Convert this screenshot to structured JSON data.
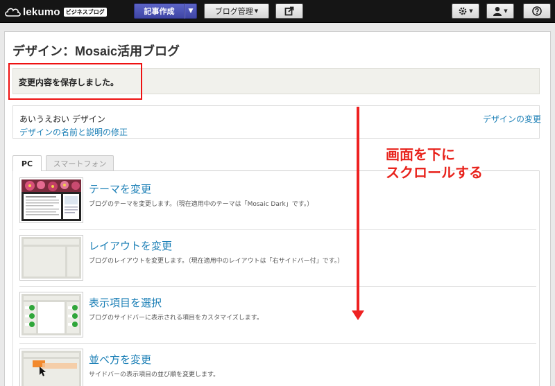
{
  "topbar": {
    "logo_text": "lekumo",
    "logo_badge": "ビジネスブログ",
    "new_post_label": "記事作成",
    "blog_mgmt_label": "ブログ管理",
    "icons": [
      "cloud-logo-icon",
      "external-link-icon",
      "gear-icon",
      "user-icon",
      "help-icon"
    ]
  },
  "page": {
    "title": "デザイン：Mosaic活用ブログ",
    "saved_message": "変更内容を保存しました。",
    "design_name": "あいうえおい デザイン",
    "design_edit_link": "デザインの名前と説明の修正",
    "design_change_link": "デザインの変更"
  },
  "tabs": [
    {
      "label": "PC",
      "active": true
    },
    {
      "label": "スマートフォン",
      "active": false
    }
  ],
  "items": [
    {
      "title": "テーマを変更",
      "desc": "ブログのテーマを変更します。（現在適用中のテーマは「Mosaic Dark」です。）"
    },
    {
      "title": "レイアウトを変更",
      "desc": "ブログのレイアウトを変更します。（現在適用中のレイアウトは「右サイドバー付」です。）"
    },
    {
      "title": "表示項目を選択",
      "desc": "ブログのサイドバーに表示される項目をカスタマイズします。"
    },
    {
      "title": "並べ方を変更",
      "desc": "サイドバーの表示項目の並び順を変更します。"
    }
  ],
  "annotation": {
    "line1": "画面を下に",
    "line2": "スクロールする",
    "color": "#e8231c"
  },
  "colors": {
    "link": "#1b7fb6",
    "topbar": "#151515",
    "new_post": "#4a52b8"
  }
}
